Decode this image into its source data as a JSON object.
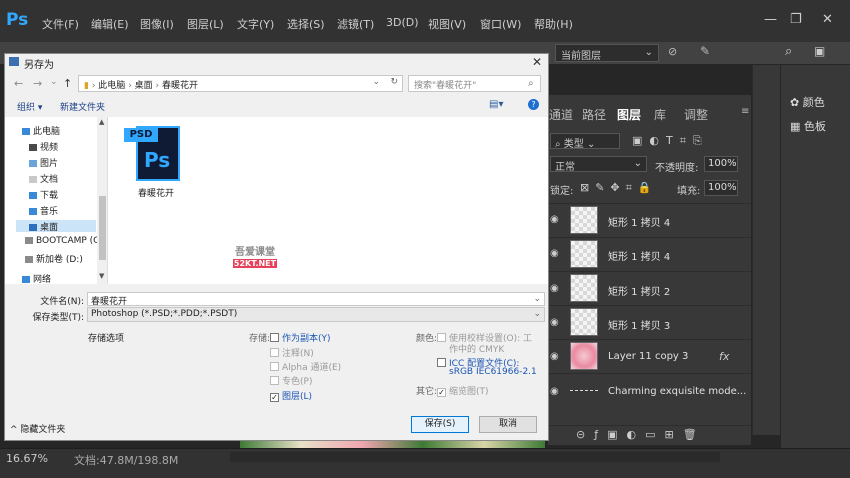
{
  "app": {
    "logo": "Ps"
  },
  "menu": [
    "文件(F)",
    "编辑(E)",
    "图像(I)",
    "图层(L)",
    "文字(Y)",
    "选择(S)",
    "滤镜(T)",
    "3D(D)",
    "视图(V)",
    "窗口(W)",
    "帮助(H)"
  ],
  "options_bar": {
    "sample_layer": "当前图层"
  },
  "right_panel": {
    "color_label": "颜色",
    "swatches_label": "色板"
  },
  "layers_panel": {
    "tabs": [
      "通道",
      "路径",
      "图层",
      "库",
      "调整"
    ],
    "filter_kind": "类型",
    "blend_mode": "正常",
    "opacity_label": "不透明度:",
    "opacity_value": "100%",
    "lock_label": "锁定:",
    "fill_label": "填充:",
    "fill_value": "100%",
    "layers": [
      "矩形 1 拷贝 4",
      "矩形 1 拷贝 4",
      "矩形 1 拷贝 2",
      "矩形 1 拷贝 3",
      "Layer 11 copy 3",
      "Charming exquisite mode..."
    ],
    "fx_label": "fx"
  },
  "status_bar": {
    "zoom": "16.67%",
    "doc": "文档:47.8M/198.8M"
  },
  "dialog": {
    "title": "另存为",
    "breadcrumb": [
      "此电脑",
      "桌面",
      "春暖花开"
    ],
    "search_placeholder": "搜索\"春暖花开\"",
    "organize": "组织 ▾",
    "new_folder": "新建文件夹",
    "tree": [
      "此电脑",
      "视频",
      "图片",
      "文档",
      "下载",
      "音乐",
      "桌面",
      "BOOTCAMP (C:",
      "新加卷 (D:)",
      "网络"
    ],
    "file_name": "春暖花开",
    "file_icon_text": "PSD",
    "file_icon_logo": "Ps",
    "watermark_top": "吾爱课堂",
    "watermark_bottom": "52KT.NET",
    "filename_label": "文件名(N):",
    "filename_value": "春暖花开",
    "savetype_label": "保存类型(T):",
    "savetype_value": "Photoshop (*.PSD;*.PDD;*.PSDT)",
    "save_options": "存储选项",
    "save_label": "存储:",
    "as_copy": "作为副本(Y)",
    "notes": "注释(N)",
    "alpha": "Alpha 通道(E)",
    "spot": "专色(P)",
    "layers_opt": "图层(L)",
    "color_label": "颜色:",
    "proof_line1": "使用校样设置(O): 工",
    "proof_line2": "作中的 CMYK",
    "icc_line1": "ICC 配置文件(C):",
    "icc_line2": "sRGB IEC61966-2.1",
    "other_label": "其它:",
    "thumbnail": "缩览图(T)",
    "hide_folders": "隐藏文件夹",
    "save_button": "保存(S)",
    "cancel_button": "取消"
  }
}
